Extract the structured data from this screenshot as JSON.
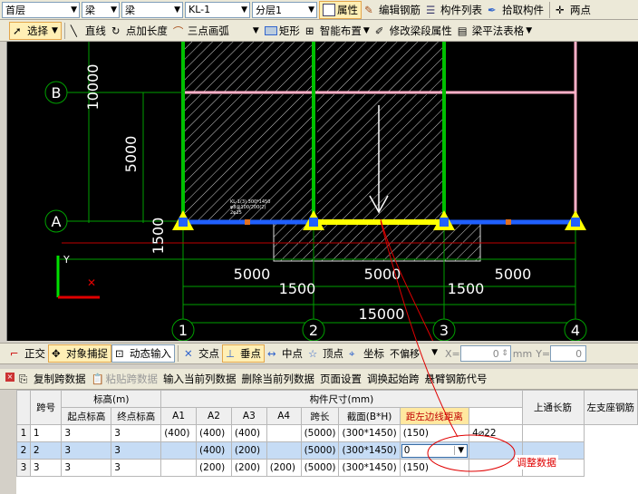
{
  "toolbar1": {
    "floor": "首层",
    "cat1": "梁",
    "cat2": "梁",
    "member": "KL-1",
    "layer": "分层1",
    "props": "属性",
    "edit_rebar": "编辑钢筋",
    "member_list": "构件列表",
    "pick": "拾取构件",
    "two_point": "两点"
  },
  "toolbar2": {
    "select": "选择",
    "line": "直线",
    "point_len": "点加长度",
    "arc3": "三点画弧",
    "rect": "矩形",
    "smart": "智能布置",
    "modify": "修改梁段属性",
    "flat_table": "梁平法表格"
  },
  "cad": {
    "axis_b": "B",
    "axis_a": "A",
    "dim_10000": "10000",
    "dim_5000_v": "5000",
    "dim_1500_v": "1500",
    "dim_5000_a": "5000",
    "dim_5000_b": "5000",
    "dim_5000_c": "5000",
    "dim_1500_a": "1500",
    "dim_1500_b": "1500",
    "dim_15000": "15000",
    "col1": "1",
    "col2": "2",
    "col3": "3",
    "col4": "4",
    "y_label": "Y",
    "beam_note1": "KL-1(3) 300*1450",
    "beam_note2": "φ8@100/200(2)",
    "beam_note3": "2φ25"
  },
  "snapbar": {
    "ortho": "正交",
    "snap": "对象捕捉",
    "dyn": "动态输入",
    "intersect": "交点",
    "perp": "垂点",
    "mid": "中点",
    "vertex": "顶点",
    "coord": "坐标",
    "offset": "不偏移",
    "x_label": "X=",
    "x_val": "0",
    "mm1": "mm",
    "y_label": "Y=",
    "y_val": "0"
  },
  "gridtools": {
    "copy": "复制跨数据",
    "paste": "粘贴跨数据",
    "input_col": "输入当前列数据",
    "del_col": "删除当前列数据",
    "page": "页面设置",
    "swap": "调换起始跨",
    "cant": "悬臂钢筋代号"
  },
  "table": {
    "h_span": "跨号",
    "h_elev": "标高(m)",
    "h_start": "起点标高",
    "h_end": "终点标高",
    "h_size": "构件尺寸(mm)",
    "h_a1": "A1",
    "h_a2": "A2",
    "h_a3": "A3",
    "h_a4": "A4",
    "h_len": "跨长",
    "h_sec": "截面(B*H)",
    "h_dist": "距左边线距离",
    "h_top": "上通长筋",
    "h_left": "左支座钢筋",
    "rows": [
      {
        "n": "1",
        "span": "1",
        "s": "3",
        "e": "3",
        "a1": "(400)",
        "a2": "(400)",
        "a3": "(400)",
        "a4": "",
        "len": "(5000)",
        "sec": "(300*1450)",
        "dist": "(150)",
        "top": "4⌀22"
      },
      {
        "n": "2",
        "span": "2",
        "s": "3",
        "e": "3",
        "a1": "",
        "a2": "(400)",
        "a3": "(200)",
        "a4": "",
        "len": "(5000)",
        "sec": "(300*1450)",
        "dist": "0",
        "top": ""
      },
      {
        "n": "3",
        "span": "3",
        "s": "3",
        "e": "3",
        "a1": "",
        "a2": "(200)",
        "a3": "(200)",
        "a4": "(200)",
        "len": "(5000)",
        "sec": "(300*1450)",
        "dist": "(150)",
        "top": ""
      }
    ],
    "annotation": "调整数据"
  },
  "colors": {
    "accent": "#ffe8a0",
    "beam": "#ffff00",
    "column": "#00c000",
    "annot": "#e00000"
  }
}
